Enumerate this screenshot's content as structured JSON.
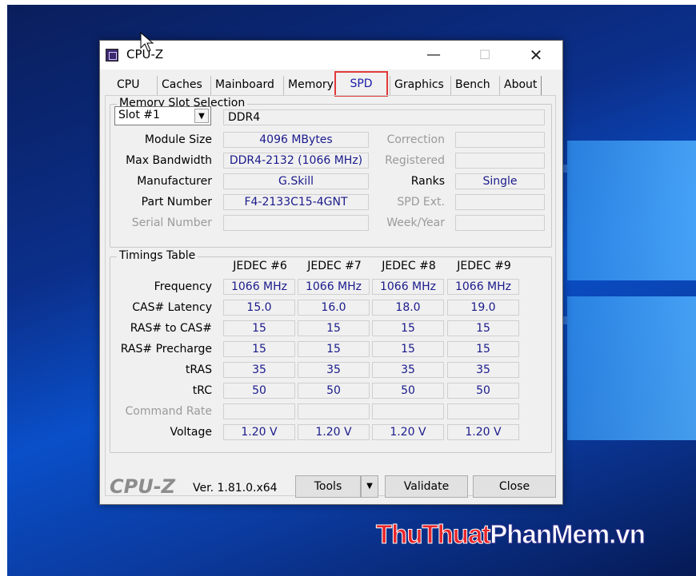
{
  "window": {
    "title": "CPU-Z",
    "minimize": "—",
    "maximize": "☐",
    "close": "✕"
  },
  "tabs": [
    {
      "label": "CPU"
    },
    {
      "label": "Caches"
    },
    {
      "label": "Mainboard"
    },
    {
      "label": "Memory"
    },
    {
      "label": "SPD",
      "active": true
    },
    {
      "label": "Graphics"
    },
    {
      "label": "Bench"
    },
    {
      "label": "About"
    }
  ],
  "memory_slot": {
    "group_title": "Memory Slot Selection",
    "slot_value": "Slot #1",
    "type": "DDR4",
    "labels": {
      "module_size": "Module Size",
      "max_bandwidth": "Max Bandwidth",
      "manufacturer": "Manufacturer",
      "part_number": "Part Number",
      "serial_number": "Serial Number",
      "correction": "Correction",
      "registered": "Registered",
      "ranks": "Ranks",
      "spd_ext": "SPD Ext.",
      "week_year": "Week/Year"
    },
    "values": {
      "module_size": "4096 MBytes",
      "max_bandwidth": "DDR4-2132 (1066 MHz)",
      "manufacturer": "G.Skill",
      "part_number": "F4-2133C15-4GNT",
      "serial_number": "",
      "correction": "",
      "registered": "",
      "ranks": "Single",
      "spd_ext": "",
      "week_year": ""
    }
  },
  "timings": {
    "group_title": "Timings Table",
    "columns": [
      "JEDEC #6",
      "JEDEC #7",
      "JEDEC #8",
      "JEDEC #9"
    ],
    "rows": [
      {
        "label": "Frequency",
        "values": [
          "1066 MHz",
          "1066 MHz",
          "1066 MHz",
          "1066 MHz"
        ]
      },
      {
        "label": "CAS# Latency",
        "values": [
          "15.0",
          "16.0",
          "18.0",
          "19.0"
        ]
      },
      {
        "label": "RAS# to CAS#",
        "values": [
          "15",
          "15",
          "15",
          "15"
        ]
      },
      {
        "label": "RAS# Precharge",
        "values": [
          "15",
          "15",
          "15",
          "15"
        ]
      },
      {
        "label": "tRAS",
        "values": [
          "35",
          "35",
          "35",
          "35"
        ]
      },
      {
        "label": "tRC",
        "values": [
          "50",
          "50",
          "50",
          "50"
        ]
      },
      {
        "label": "Command Rate",
        "values": [
          "",
          "",
          "",
          ""
        ],
        "dim": true
      },
      {
        "label": "Voltage",
        "values": [
          "1.20 V",
          "1.20 V",
          "1.20 V",
          "1.20 V"
        ]
      }
    ]
  },
  "footer": {
    "brand": "CPU-Z",
    "version": "Ver. 1.81.0.x64",
    "tools": "Tools",
    "tools_arrow": "▼",
    "validate": "Validate",
    "close": "Close"
  },
  "watermark": {
    "part1": "ThuThuat",
    "part2": "PhanMem",
    "part3": ".vn"
  }
}
